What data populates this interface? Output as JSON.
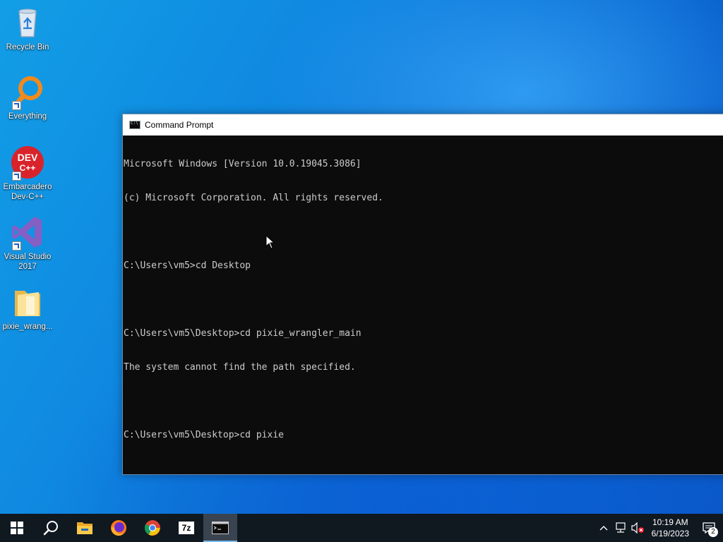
{
  "desktop": {
    "icons": [
      {
        "label": "Recycle Bin",
        "icon": "recycle-bin-icon"
      },
      {
        "label": "Everything",
        "icon": "everything-search-icon"
      },
      {
        "label": "Embarcadero Dev-C++",
        "icon": "devcpp-icon"
      },
      {
        "label": "Visual Studio 2017",
        "icon": "visual-studio-icon"
      },
      {
        "label": "pixie_wrang...",
        "icon": "folder-icon"
      }
    ]
  },
  "cmd": {
    "title": "Command Prompt",
    "lines": [
      "Microsoft Windows [Version 10.0.19045.3086]",
      "(c) Microsoft Corporation. All rights reserved.",
      "",
      "C:\\Users\\vm5>cd Desktop",
      "",
      "C:\\Users\\vm5\\Desktop>cd pixie_wrangler_main",
      "The system cannot find the path specified.",
      "",
      "C:\\Users\\vm5\\Desktop>cd pixie"
    ]
  },
  "taskbar": {
    "buttons": [
      "start-icon",
      "search-icon",
      "file-explorer-icon",
      "firefox-icon",
      "chrome-icon",
      "7zip-icon",
      "command-prompt-icon"
    ],
    "sevenzip_label": "7z",
    "time": "10:19 AM",
    "date": "6/19/2023",
    "notification_count": "2"
  },
  "colors": {
    "console_bg": "#0c0c0c",
    "console_text": "#cccccc",
    "taskbar_bg": "#101820"
  }
}
